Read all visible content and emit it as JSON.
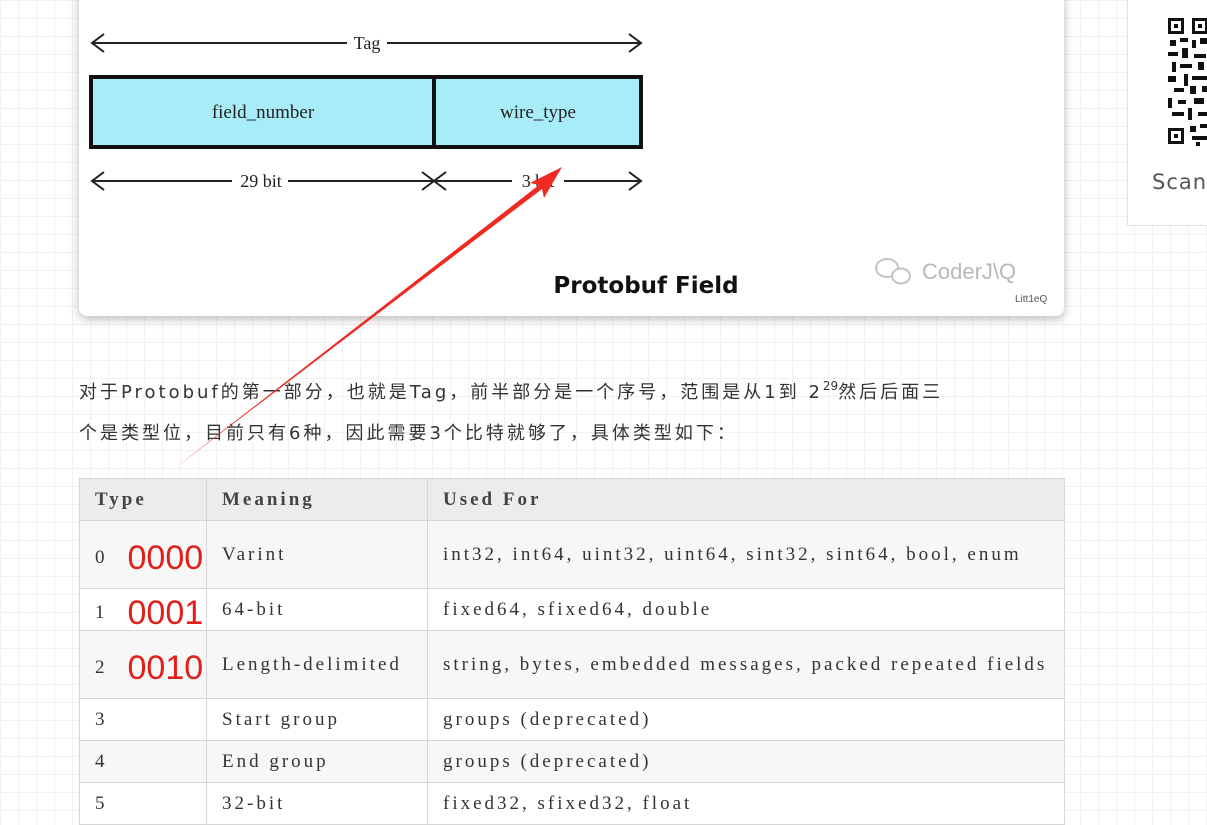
{
  "figure": {
    "tag_label": "Tag",
    "box_left_label": "field_number",
    "box_right_label": "wire_type",
    "left_bits_label": "29 bit",
    "right_bits_label": "3 bit",
    "caption": "Protobuf Field",
    "watermark": "CoderJ\\Q",
    "watermark_sub": "Litt1eQ",
    "box_fill": "#a8ecf8"
  },
  "sidebar": {
    "scan_label": "Scan"
  },
  "paragraph": {
    "line1_before": "对于Protobuf的第一部分，也就是Tag，前半部分是一个序号，范围是从1到 2",
    "exponent": "29",
    "line1_after": "然后后面三",
    "line2": "个是类型位，目前只有6种，因此需要3个比特就够了，具体类型如下："
  },
  "table": {
    "headers": [
      "Type",
      "Meaning",
      "Used For"
    ],
    "rows": [
      {
        "type": "0",
        "annotation": "0000",
        "meaning": "Varint",
        "used_for": "int32, int64, uint32, uint64, sint32, sint64, bool, enum"
      },
      {
        "type": "1",
        "annotation": "0001",
        "meaning": "64-bit",
        "used_for": "fixed64, sfixed64, double"
      },
      {
        "type": "2",
        "annotation": "0010",
        "meaning": "Length-delimited",
        "used_for": "string, bytes, embedded messages, packed repeated fields"
      },
      {
        "type": "3",
        "annotation": "",
        "meaning": "Start group",
        "used_for": "groups (deprecated)"
      },
      {
        "type": "4",
        "annotation": "",
        "meaning": "End group",
        "used_for": "groups (deprecated)"
      },
      {
        "type": "5",
        "annotation": "",
        "meaning": "32-bit",
        "used_for": "fixed32, sfixed32, float"
      }
    ]
  },
  "colors": {
    "annotation_red": "#e0201a",
    "arrow_red": "#ee2a22"
  }
}
